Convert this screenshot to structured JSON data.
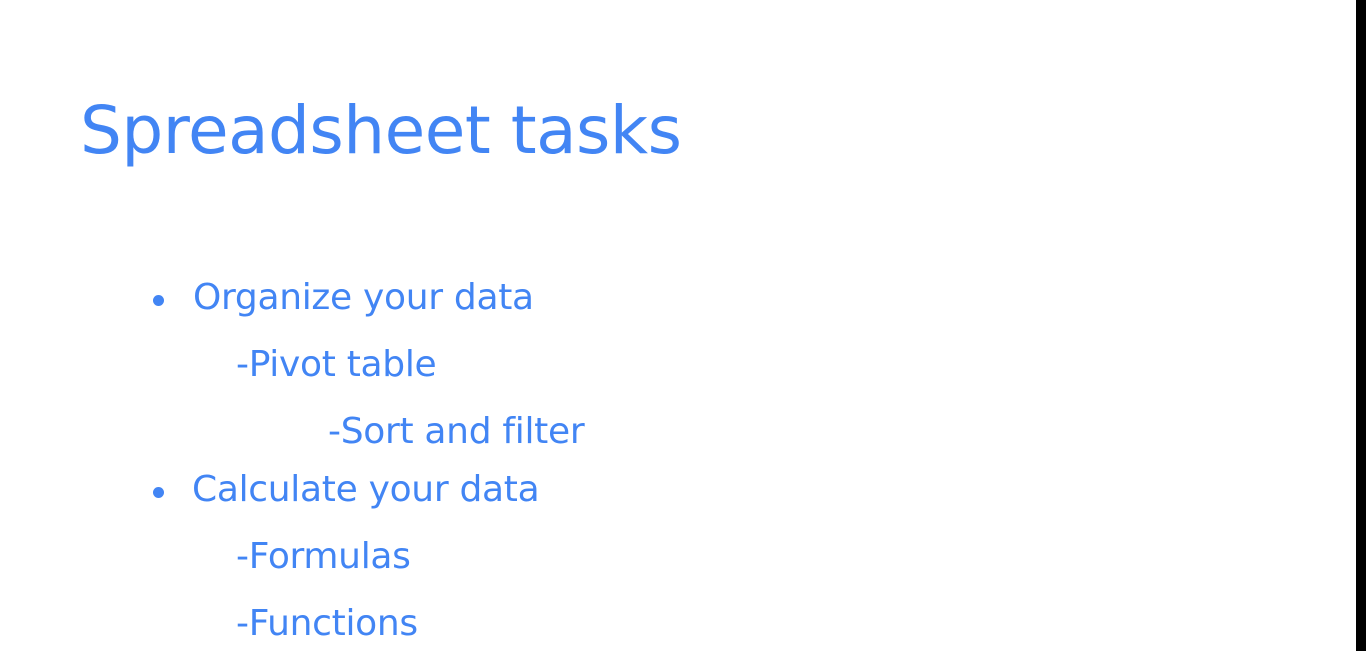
{
  "slide": {
    "title": "Spreadsheet tasks",
    "items": [
      {
        "text": "Organize your data",
        "level": 1,
        "bullet": "bullet-dot"
      },
      {
        "text": "-Pivot table",
        "level": 2
      },
      {
        "text": "-Sort and filter",
        "level": 3
      },
      {
        "text": "Calculate your data",
        "level": 1,
        "bullet": "bullet-dot"
      },
      {
        "text": "-Formulas",
        "level": 2
      },
      {
        "text": "-Functions",
        "level": 2
      }
    ]
  },
  "colors": {
    "text": "#4285f4",
    "background": "#ffffff"
  }
}
